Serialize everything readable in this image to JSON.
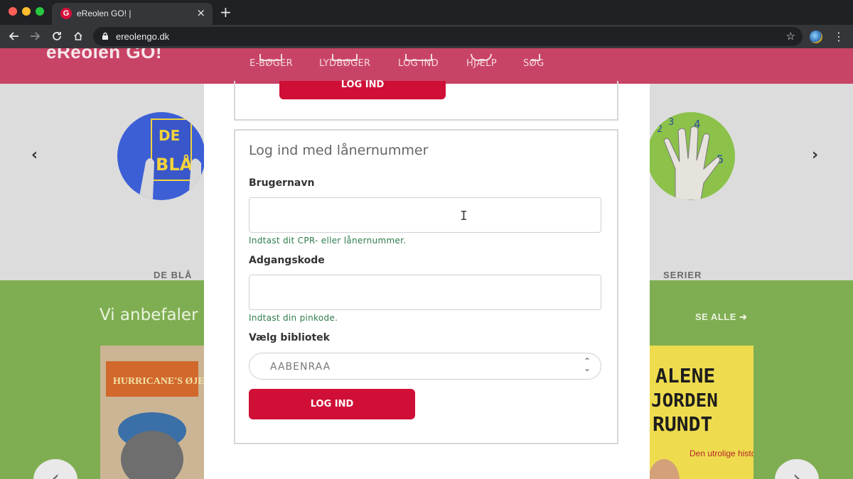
{
  "browser": {
    "tab_title": "eReolen GO! |",
    "tab_favicon_letter": "G",
    "tab_close": "×",
    "new_tab": "+",
    "url": "ereolengo.dk",
    "star": "☆",
    "menu": "⋮"
  },
  "site": {
    "logo": "eReolen GO!",
    "nav": [
      "E-BØGER",
      "LYDBØGER",
      "LOG IND",
      "HJÆLP",
      "SØG"
    ]
  },
  "carousel": {
    "prev": "‹",
    "next": "›",
    "categories": [
      {
        "label": "DE BLÅ",
        "image_text": "DE BLÅ"
      },
      {
        "label": "SERIER",
        "image_text": "1 2 3 4 5"
      }
    ]
  },
  "recommended": {
    "title": "Vi anbefaler",
    "see_all": "SE ALLE ➜",
    "prev": "‹",
    "next": "›",
    "books": [
      {
        "cover_text": "HURRICANE'S ØJE"
      },
      {
        "cover_text": "ALENE JORDEN RUNDT",
        "subtitle": "Den utrolige historie om"
      }
    ]
  },
  "modal": {
    "top_button": "LOG IND",
    "section_title": "Log ind med lånernummer",
    "username_label": "Brugernavn",
    "username_value": "",
    "username_hint": "Indtast dit CPR- eller lånernummer.",
    "password_label": "Adgangskode",
    "password_value": "",
    "password_hint": "Indtast din pinkode.",
    "library_label": "Vælg bibliotek",
    "library_selected": "AABENRAA",
    "login_button": "LOG IND"
  },
  "colors": {
    "brand_red": "#cf0f36",
    "header_pink": "#c84466",
    "green": "#7fae52",
    "hint_green": "#2e7d4a"
  }
}
